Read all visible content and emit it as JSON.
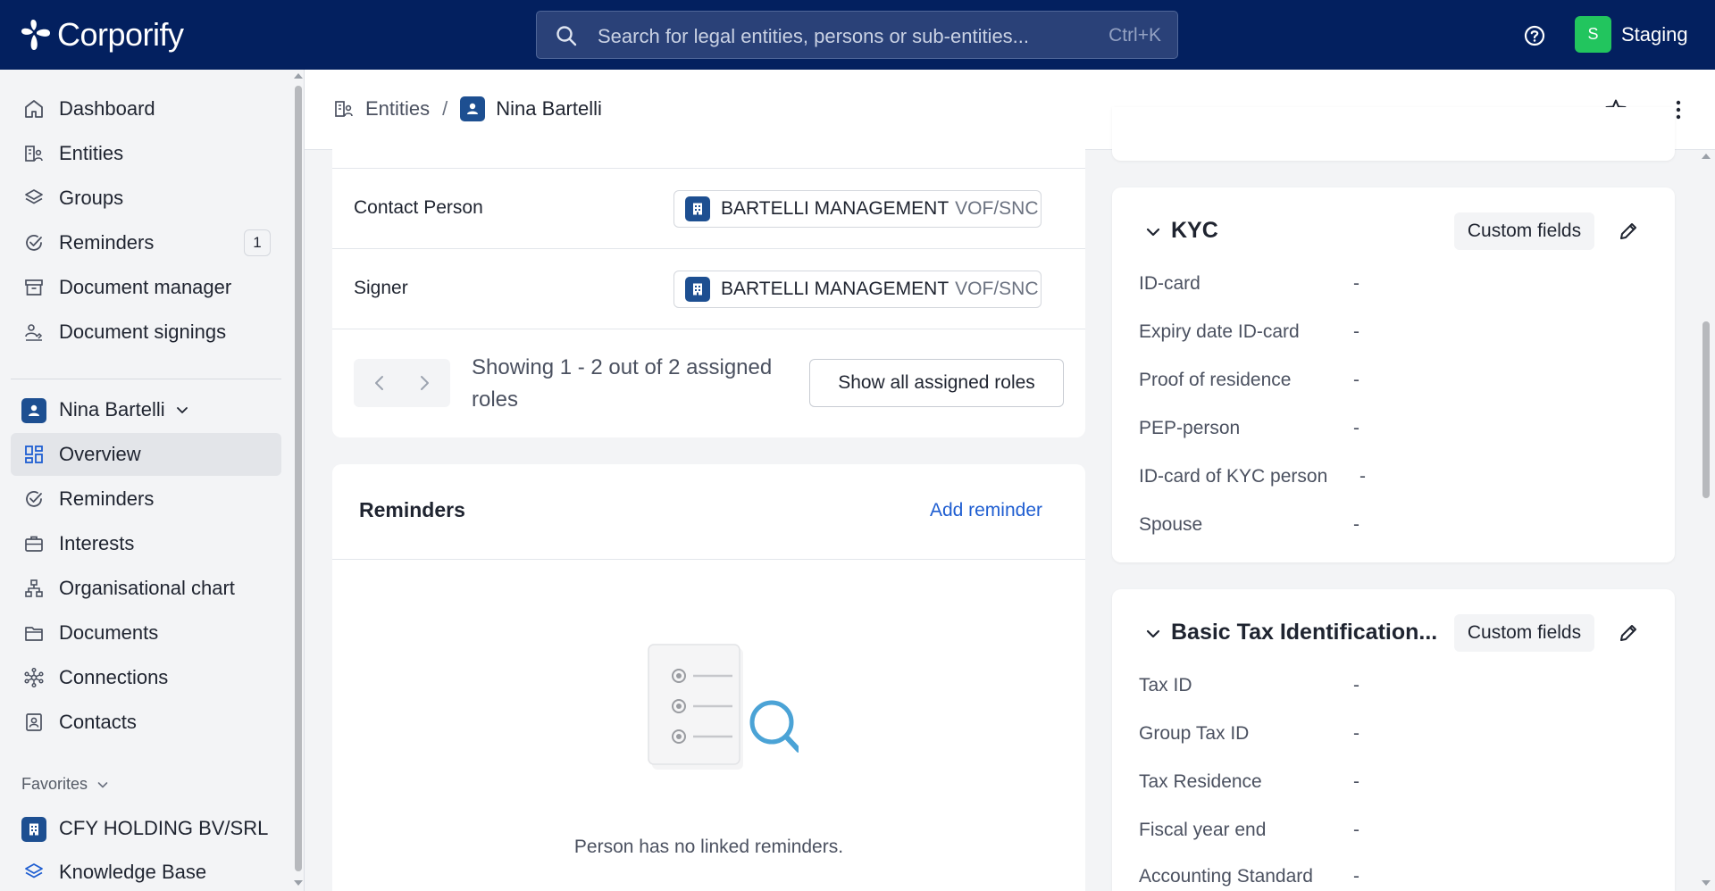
{
  "app": {
    "name": "Corporify"
  },
  "search": {
    "placeholder": "Search for legal entities, persons or sub-entities...",
    "shortcut": "Ctrl+K"
  },
  "environment": {
    "badge": "S",
    "label": "Staging"
  },
  "sidebar": {
    "main_items": [
      {
        "label": "Dashboard",
        "icon": "home-icon"
      },
      {
        "label": "Entities",
        "icon": "entities-icon"
      },
      {
        "label": "Groups",
        "icon": "layers-icon"
      },
      {
        "label": "Reminders",
        "icon": "check-circle-icon",
        "badge": "1"
      },
      {
        "label": "Document manager",
        "icon": "archive-icon"
      },
      {
        "label": "Document signings",
        "icon": "signature-icon"
      }
    ],
    "entity": {
      "name": "Nina Bartelli"
    },
    "entity_items": [
      {
        "label": "Overview",
        "icon": "grid-icon",
        "active": true
      },
      {
        "label": "Reminders",
        "icon": "check-circle-icon"
      },
      {
        "label": "Interests",
        "icon": "briefcase-icon"
      },
      {
        "label": "Organisational chart",
        "icon": "org-chart-icon"
      },
      {
        "label": "Documents",
        "icon": "folder-icon"
      },
      {
        "label": "Connections",
        "icon": "network-icon"
      },
      {
        "label": "Contacts",
        "icon": "contact-card-icon"
      }
    ],
    "favorites_label": "Favorites",
    "favorites": [
      {
        "label": "CFY HOLDING BV/SRL",
        "icon": "building-icon"
      },
      {
        "label": "Knowledge Base",
        "icon": "layers-icon"
      }
    ]
  },
  "breadcrumb": {
    "entities": "Entities",
    "separator": "/",
    "current": "Nina Bartelli"
  },
  "roles": {
    "rows": [
      {
        "role": "Contact Person",
        "entity_name": "BARTELLI MANAGEMENT",
        "entity_type": "VOF/SNC"
      },
      {
        "role": "Signer",
        "entity_name": "BARTELLI MANAGEMENT",
        "entity_type": "VOF/SNC"
      }
    ],
    "showing_text": "Showing 1 - 2 out of 2 assigned roles",
    "show_all_label": "Show all assigned roles"
  },
  "reminders": {
    "title": "Reminders",
    "add_label": "Add reminder",
    "empty_text": "Person has no linked reminders."
  },
  "kyc": {
    "title": "KYC",
    "custom_fields_label": "Custom fields",
    "fields": [
      {
        "label": "ID-card",
        "value": "-"
      },
      {
        "label": "Expiry date ID-card",
        "value": "-"
      },
      {
        "label": "Proof of residence",
        "value": "-"
      },
      {
        "label": "PEP-person",
        "value": "-"
      },
      {
        "label": "ID-card of KYC person",
        "value": "-"
      },
      {
        "label": "Spouse",
        "value": "-"
      }
    ]
  },
  "tax": {
    "title": "Basic Tax Identification...",
    "custom_fields_label": "Custom fields",
    "fields": [
      {
        "label": "Tax ID",
        "value": "-"
      },
      {
        "label": "Group Tax ID",
        "value": "-"
      },
      {
        "label": "Tax Residence",
        "value": "-"
      },
      {
        "label": "Fiscal year end",
        "value": "-"
      },
      {
        "label": "Accounting Standard",
        "value": "-"
      }
    ]
  },
  "colors": {
    "topbar": "#03205f",
    "accent_link": "#1f5ed1",
    "env_badge": "#22c55e",
    "entity_badge": "#1d4f91"
  }
}
